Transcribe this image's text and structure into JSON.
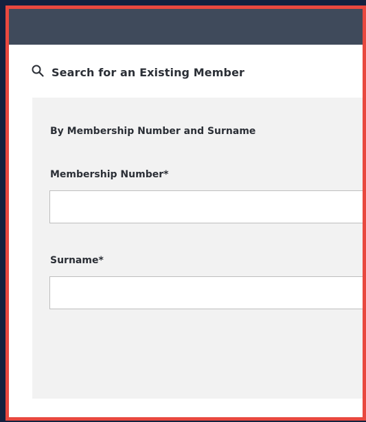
{
  "colors": {
    "page_background": "#13213f",
    "frame_border": "#e8483f",
    "top_bar": "#3f4a5b",
    "panel": "#f2f2f2",
    "text": "#2b2f36"
  },
  "search": {
    "icon": "search-icon",
    "heading": "Search for an Existing Member"
  },
  "form": {
    "section_title": "By Membership Number and Surname",
    "membership_number": {
      "label": "Membership Number*",
      "value": "",
      "placeholder": ""
    },
    "surname": {
      "label": "Surname*",
      "value": "",
      "placeholder": ""
    }
  }
}
